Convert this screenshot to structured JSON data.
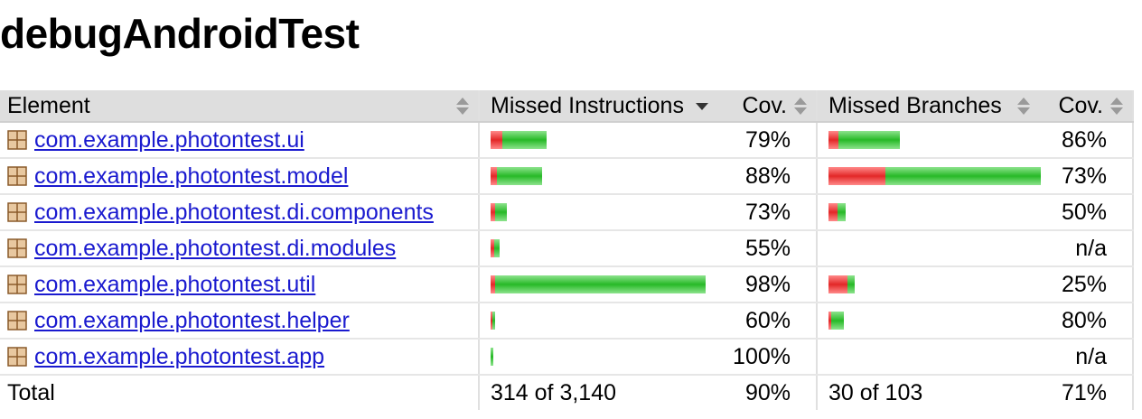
{
  "page_title": "debugAndroidTest",
  "columns": {
    "element": "Element",
    "missed_instructions": "Missed Instructions",
    "cov1": "Cov.",
    "missed_branches": "Missed Branches",
    "cov2": "Cov."
  },
  "colors": {
    "missed": "#e32727",
    "covered": "#27b927",
    "link": "#1a1acf"
  },
  "rows": [
    {
      "name": "com.example.photontest.ui",
      "instr_missed_frac": 0.21,
      "instr_total_rel": 0.26,
      "instr_cov": "79%",
      "branch_missed_frac": 0.14,
      "branch_total_rel": 0.33,
      "branch_cov": "86%"
    },
    {
      "name": "com.example.photontest.model",
      "instr_missed_frac": 0.12,
      "instr_total_rel": 0.24,
      "instr_cov": "88%",
      "branch_missed_frac": 0.27,
      "branch_total_rel": 1.0,
      "branch_cov": "73%"
    },
    {
      "name": "com.example.photontest.di.components",
      "instr_missed_frac": 0.27,
      "instr_total_rel": 0.075,
      "instr_cov": "73%",
      "branch_missed_frac": 0.5,
      "branch_total_rel": 0.08,
      "branch_cov": "50%"
    },
    {
      "name": "com.example.photontest.di.modules",
      "instr_missed_frac": 0.45,
      "instr_total_rel": 0.04,
      "instr_cov": "55%",
      "branch_missed_frac": 0,
      "branch_total_rel": 0,
      "branch_cov": "n/a"
    },
    {
      "name": "com.example.photontest.util",
      "instr_missed_frac": 0.02,
      "instr_total_rel": 1.0,
      "instr_cov": "98%",
      "branch_missed_frac": 0.75,
      "branch_total_rel": 0.12,
      "branch_cov": "25%"
    },
    {
      "name": "com.example.photontest.helper",
      "instr_missed_frac": 0.4,
      "instr_total_rel": 0.02,
      "instr_cov": "60%",
      "branch_missed_frac": 0.2,
      "branch_total_rel": 0.07,
      "branch_cov": "80%"
    },
    {
      "name": "com.example.photontest.app",
      "instr_missed_frac": 0,
      "instr_total_rel": 0.008,
      "instr_cov": "100%",
      "branch_missed_frac": 0,
      "branch_total_rel": 0,
      "branch_cov": "n/a"
    }
  ],
  "total": {
    "label": "Total",
    "instr": "314 of 3,140",
    "instr_cov": "90%",
    "branch": "30 of 103",
    "branch_cov": "71%"
  }
}
